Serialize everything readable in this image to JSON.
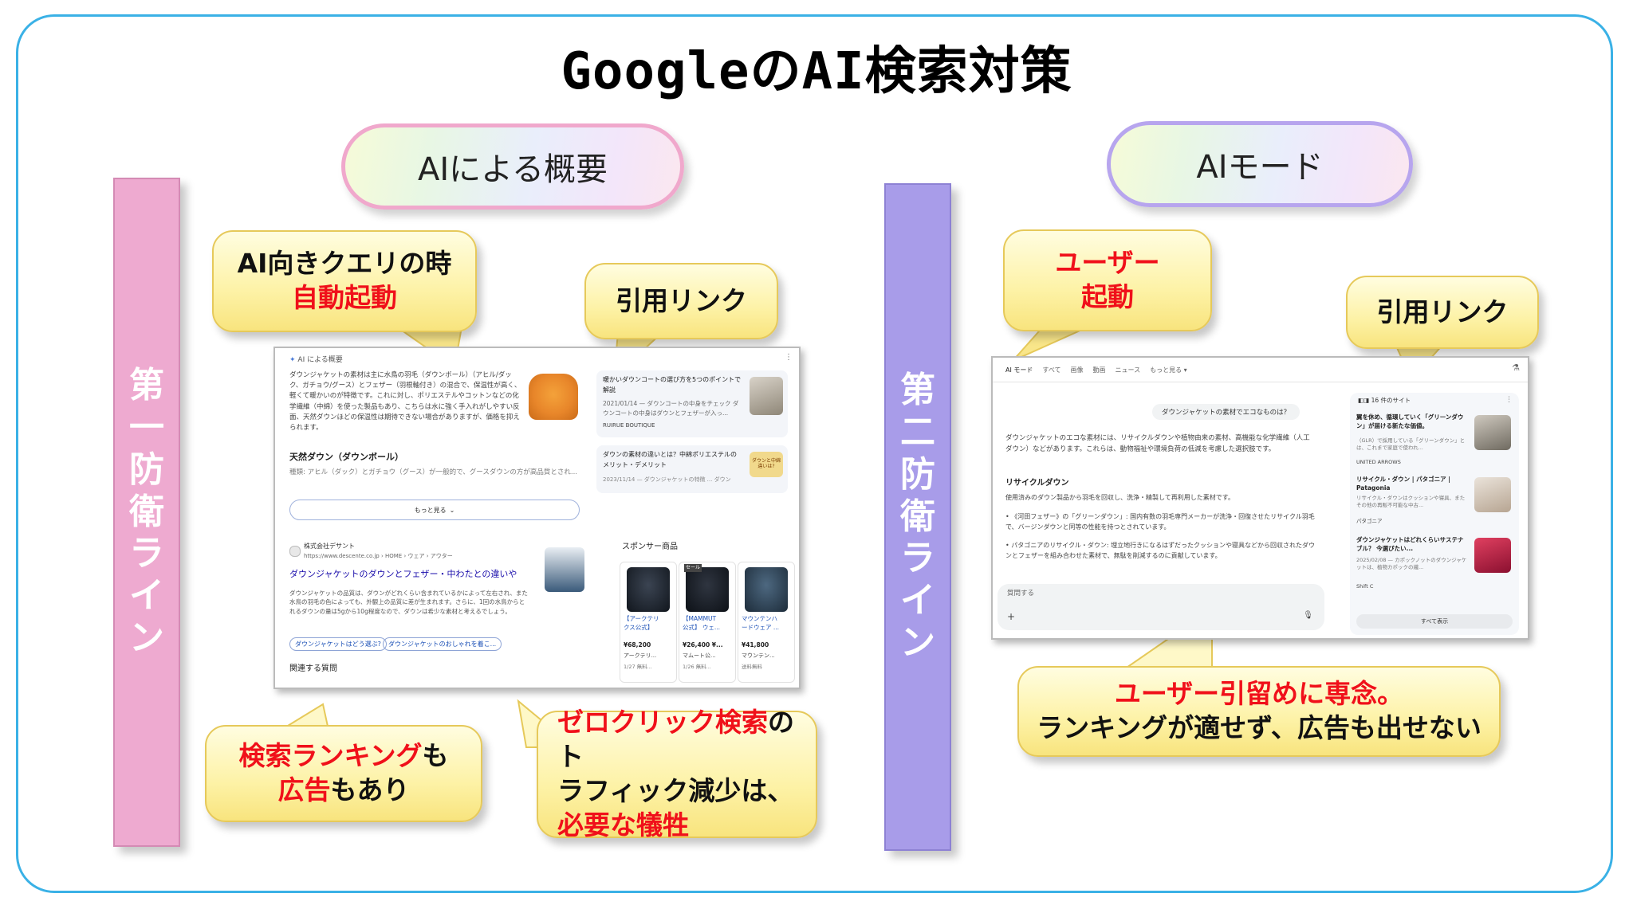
{
  "title": "GoogleのAI検索対策",
  "left": {
    "pill": "AIによる概要",
    "bar_label": [
      "第",
      "一",
      "防",
      "衛",
      "ラ",
      "イ",
      "ン"
    ],
    "callout_auto": {
      "line1": "AI向きクエリの時",
      "line2": "自動起動"
    },
    "callout_cite": "引用リンク",
    "callout_rank": {
      "part1_red": "検索ランキング",
      "part1_rest": "も",
      "part2_red": "広告",
      "part2_rest": "もあり"
    },
    "callout_zero": {
      "line1_red": "ゼロクリック検索",
      "line1_rest": "のト",
      "line2": "ラフィック減少は、",
      "line3_red": "必要な犠牲"
    },
    "shot": {
      "header": "AI による概要",
      "body": "ダウンジャケットの素材は主に水鳥の羽毛（ダウンボール）（アヒル/ダック、ガチョウ/グース）とフェザー（羽根軸付き）の混合で、保温性が高く、軽くて暖かいのが特徴です。これに対し、ポリエステルやコットンなどの化学繊維（中綿）を使った製品もあり、こちらは水に強く手入れがしやすい反面、天然ダウンほどの保温性は期待できない場合がありますが、価格を抑えられます。",
      "heading": "天然ダウン（ダウンボール）",
      "bullet": "種類: アヒル（ダック）とガチョウ（グース）が一般的で、グースダウンの方が高品質とされ...",
      "more": "もっと見る",
      "side1_title": "暖かいダウンコートの選び方を5つのポイントで解説",
      "side1_meta": "2021/01/14 — ダウンコートの中身をチェック ダウンコートの中身はダウンとフェザーが入っ...",
      "side1_source": "RUIRUE BOUTIQUE",
      "side2_title": "ダウンの素材の違いとは？中綿ポリエステルのメリット・デメリット",
      "side2_meta": "2023/11/14 — ダウンジャケットの特徴 ... ダウン",
      "side2_badge": "ダウンと中綿 違いは?",
      "result_site": "株式会社デサント",
      "result_url": "https://www.descente.co.jp › HOME › ウェア › アウター",
      "result_title": "ダウンジャケットのダウンとフェザー・中わたとの違いや",
      "result_desc": "ダウンジャケットの品質は、ダウンがどれくらい含まれているかによって左右され、また水鳥の羽毛の色によっても、外観上の品質に差が生まれます。さらに、1回の水鳥からとれるダウンの量は5gから10g程度なので、ダウンは希少な素材と考えるでしょう。",
      "chip1": "ダウンジャケットはどう選ぶ?",
      "chip2": "ダウンジャケットのおしゃれを着こ...",
      "related": "関連する質問",
      "sponsor": "スポンサー商品",
      "products": [
        {
          "name1": "【アークテリ",
          "name2": "クス公式】",
          "price": "¥68,200",
          "shop": "アークテリ...",
          "ship": "1/27 無料...",
          "sale": ""
        },
        {
          "name1": "【MAMMUT",
          "name2": "公式】 ウェ...",
          "price": "¥26,400 ¥...",
          "shop": "マムート公...",
          "ship": "1/26 無料...",
          "sale": "セール"
        },
        {
          "name1": "マウンテンハ",
          "name2": "ードウェア ...",
          "price": "¥41,800",
          "shop": "マウンテン...",
          "ship": "送料無料",
          "sale": ""
        }
      ]
    }
  },
  "right": {
    "pill": "AIモード",
    "bar_label": [
      "第",
      "二",
      "防",
      "衛",
      "ラ",
      "イ",
      "ン"
    ],
    "callout_user": {
      "line1": "ユーザー",
      "line2": "起動"
    },
    "callout_cite": "引用リンク",
    "callout_retain": {
      "line1_red": "ユーザー引留めに専念。",
      "line2": "ランキングが適せず、広告も出せない"
    },
    "shot": {
      "tabs": [
        "AI モード",
        "すべて",
        "画像",
        "動画",
        "ニュース",
        "もっと見る ▾"
      ],
      "query": "ダウンジャケットの素材でエコなものは？",
      "body": "ダウンジャケットのエコな素材には、リサイクルダウンや植物由来の素材、高機能な化学繊維（人工ダウン）などがあります。これらは、動物福祉や環境負荷の低減を考慮した選択肢です。",
      "heading": "リサイクルダウン",
      "para": "使用済みのダウン製品から羽毛を回収し、洗浄・精製して再利用した素材です。",
      "bullet1": "《河田フェザー》の「グリーンダウン」: 国内有数の羽毛専門メーカーが洗浄・回復させたリサイクル羽毛で、バージンダウンと同等の性能を持つとされています。",
      "bullet2": "パタゴニアのリサイクル・ダウン: 埋立地行きになるはずだったクッションや寝具などから回収されたダウンとフェザーを組み合わせた素材で、無駄を削減するのに貢献しています。",
      "ask": "質問する",
      "sites": "16 件のサイト",
      "cards": [
        {
          "title": "翼を休め、循環していく「グリーンダウン」が届ける新たな価値。",
          "desc": "（GLR）で採用している「グリーンダウン」とは、これまで家庭で使われ...",
          "src": "UNITED ARROWS"
        },
        {
          "title": "リサイクル・ダウン | パタゴニア | Patagonia",
          "desc": "リサイクル・ダウンはクッションや寝具、またその他の再販不可能な中古...",
          "src": "パタゴニア"
        },
        {
          "title": "ダウンジャケットはどれくらいサステナブル？ 今選びたい...",
          "desc": "2025/02/08 — カポックノットのダウンジャケットは、植物カポックの繊...",
          "src": "Shift C"
        }
      ],
      "show_all": "すべて表示"
    }
  }
}
